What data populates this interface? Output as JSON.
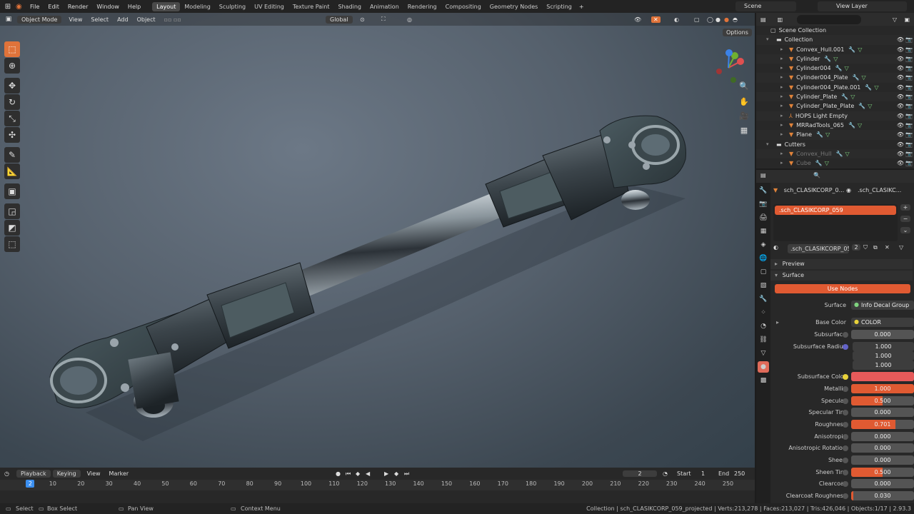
{
  "topbar": {
    "menus": [
      "File",
      "Edit",
      "Render",
      "Window",
      "Help"
    ],
    "workspaces": [
      "Layout",
      "Modeling",
      "Sculpting",
      "UV Editing",
      "Texture Paint",
      "Shading",
      "Animation",
      "Rendering",
      "Compositing",
      "Geometry Nodes",
      "Scripting"
    ],
    "add_workspace": "+",
    "scene": "Scene",
    "view_layer": "View Layer"
  },
  "viewport": {
    "mode": "Object Mode",
    "menus": [
      "View",
      "Select",
      "Add",
      "Object"
    ],
    "orientation": "Global",
    "options": "Options"
  },
  "outliner": {
    "search_placeholder": "",
    "rows": [
      {
        "name": "Scene Collection",
        "kind": "scene"
      },
      {
        "name": "Collection",
        "kind": "collection"
      },
      {
        "name": "Convex_Hull.001",
        "kind": "object"
      },
      {
        "name": "Cylinder",
        "kind": "object"
      },
      {
        "name": "Cylinder004",
        "kind": "object"
      },
      {
        "name": "Cylinder004_Plate",
        "kind": "object"
      },
      {
        "name": "Cylinder004_Plate.001",
        "kind": "object"
      },
      {
        "name": "Cylinder_Plate",
        "kind": "object"
      },
      {
        "name": "Cylinder_Plate_Plate",
        "kind": "object"
      },
      {
        "name": "HOPS Light Empty",
        "kind": "empty"
      },
      {
        "name": "MRRadTools_065",
        "kind": "object"
      },
      {
        "name": "Plane",
        "kind": "object"
      },
      {
        "name": "Cutters",
        "kind": "collection"
      },
      {
        "name": "Convex_Hull",
        "kind": "object-dim"
      },
      {
        "name": "Cube",
        "kind": "object-dim"
      }
    ]
  },
  "properties": {
    "object_name": "sch_CLASIKCORP_0...",
    "material_short": ".sch_CLASIKC...",
    "slot_name": ".sch_CLASIKCORP_059",
    "material_name": ".sch_CLASIKCORP_059",
    "users": "2",
    "panel_preview": "Preview",
    "panel_surface": "Surface",
    "use_nodes": "Use Nodes",
    "surface_label": "Surface",
    "surface_value": "Info Decal Group",
    "base_color_label": "Base Color",
    "base_color_value": "COLOR",
    "fields": [
      {
        "label": "Subsurface",
        "value": "0.000",
        "fill": 0
      },
      {
        "label": "Subsurface Color",
        "value": "",
        "fill": 1,
        "color": "#e65a5a"
      },
      {
        "label": "Metallic",
        "value": "1.000",
        "fill": 1
      },
      {
        "label": "Specular",
        "value": "0.500",
        "fill": 0.5
      },
      {
        "label": "Specular Tint",
        "value": "0.000",
        "fill": 0
      },
      {
        "label": "Roughness",
        "value": "0.701",
        "fill": 0.701
      },
      {
        "label": "Anisotropic",
        "value": "0.000",
        "fill": 0
      },
      {
        "label": "Anisotropic Rotation",
        "value": "0.000",
        "fill": 0
      },
      {
        "label": "Sheen",
        "value": "0.000",
        "fill": 0
      },
      {
        "label": "Sheen Tint",
        "value": "0.500",
        "fill": 0.5
      },
      {
        "label": "Clearcoat",
        "value": "0.000",
        "fill": 0
      },
      {
        "label": "Clearcoat Roughness",
        "value": "0.030",
        "fill": 0.03
      }
    ],
    "subsurface_radius_label": "Subsurface Radius",
    "subsurface_radius": [
      "1.000",
      "1.000",
      "1.000"
    ]
  },
  "timeline": {
    "menus": [
      "Playback",
      "Keying",
      "View",
      "Marker"
    ],
    "current_frame": "2",
    "start_label": "Start",
    "start": "1",
    "end_label": "End",
    "end": "250",
    "ticks": [
      "10",
      "20",
      "30",
      "40",
      "50",
      "60",
      "70",
      "80",
      "90",
      "100",
      "110",
      "120",
      "130",
      "140",
      "150",
      "160",
      "170",
      "180",
      "190",
      "200",
      "210",
      "220",
      "230",
      "240",
      "250"
    ]
  },
  "statusbar": {
    "select": "Select",
    "box_select": "Box Select",
    "pan_view": "Pan View",
    "context_menu": "Context Menu",
    "stats": "Collection | sch_CLASIKCORP_059_projected | Verts:213,278 | Faces:213,027 | Tris:426,046 | Objects:1/17 | 2.93.3"
  },
  "colors": {
    "accent": "#e0733a",
    "active_blue": "#3b8ff0",
    "slider_fill": "#e05a32"
  }
}
